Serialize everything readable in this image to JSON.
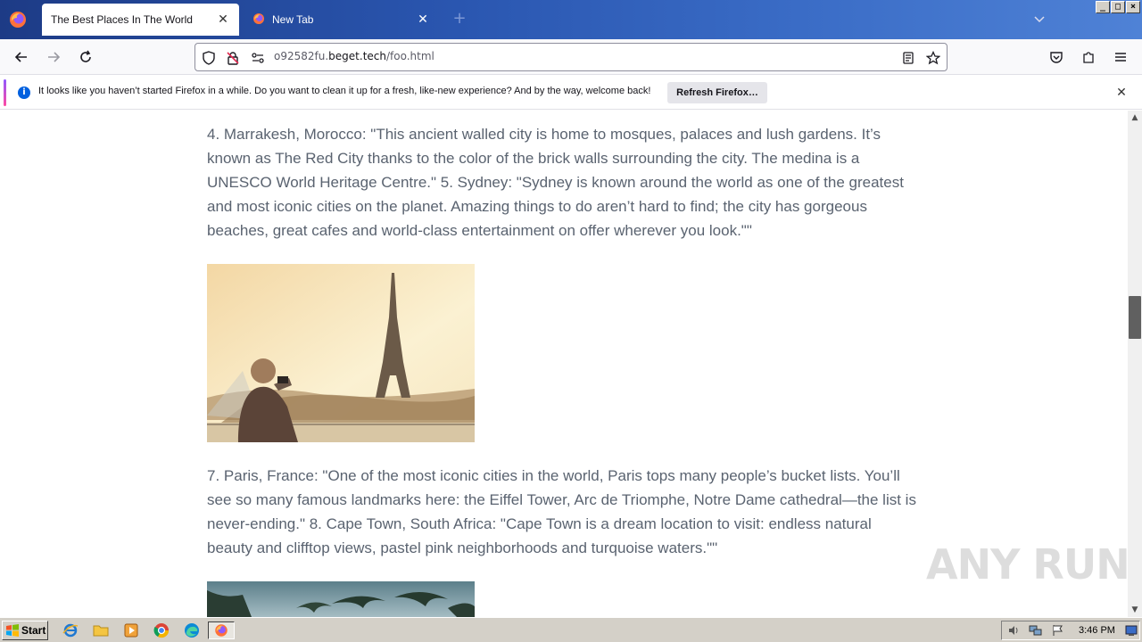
{
  "browser": {
    "tabs": [
      {
        "title": "The Best Places In The World",
        "active": true
      },
      {
        "title": "New Tab",
        "active": false
      }
    ],
    "new_tab_symbol": "+",
    "window_buttons": [
      "_",
      "□",
      "×"
    ],
    "url": {
      "prefix": "o92582fu.",
      "host": "beget.tech",
      "path": "/foo.html"
    }
  },
  "notification": {
    "message": "It looks like you haven’t started Firefox in a while. Do you want to clean it up for a fresh, like-new experience? And by the way, welcome back!",
    "button_label": "Refresh Firefox…"
  },
  "article": {
    "paragraph_1": "4. Marrakesh, Morocco: \"This ancient walled city is home to mosques, palaces and lush gardens. It’s known as The Red City thanks to the color of the brick walls surrounding the city. The medina is a UNESCO World Heritage Centre.\" 5. Sydney: \"Sydney is known around the world as one of the greatest and most iconic cities on the planet. Amazing things to do aren’t hard to find; the city has gorgeous beaches, great cafes and world-class entertainment on offer wherever you look.\"\"",
    "paragraph_2": "7. Paris, France: \"One of the most iconic cities in the world, Paris tops many people’s bucket lists. You’ll see so many famous landmarks here: the Eiffel Tower, Arc de Triomphe, Notre Dame cathedral—the list is never-ending.\" 8. Cape Town, South Africa: \"Cape Town is a dream location to visit: endless natural beauty and clifftop views, pastel pink neighborhoods and turquoise waters.\"\""
  },
  "watermark": "ANY RUN",
  "taskbar": {
    "start_label": "Start",
    "clock": "3:46 PM"
  },
  "colors": {
    "tabstrip": "#2a56b0",
    "article_text": "#5a6370",
    "notify_info": "#0060df"
  }
}
